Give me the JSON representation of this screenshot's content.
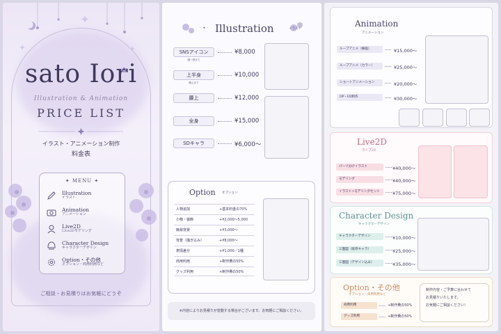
{
  "cover": {
    "name": "sato Iori",
    "subtitle": "Illustration & Animation",
    "price_list": "PRICE LIST",
    "tagline": "イラスト・アニメーション制作",
    "tagline2": "料金表",
    "menu_title": "MENU",
    "menu": [
      {
        "en": "Illustration",
        "jp": "イラスト",
        "icon": "pen-icon"
      },
      {
        "en": "Animation",
        "jp": "アニメーション",
        "icon": "camera-icon"
      },
      {
        "en": "Live2D",
        "jp": "Live2Dモデリング",
        "icon": "character-icon"
      },
      {
        "en": "Character Design",
        "jp": "キャラクターデザイン",
        "icon": "character-head-icon"
      },
      {
        "en": "Option・その他",
        "jp": "オプション・商用利用など",
        "icon": "gear-icon"
      }
    ],
    "footer": "ご相談・お見積りはお気軽にどうぞ"
  },
  "illustration": {
    "title": "Illustration",
    "sub": "イラスト",
    "items": [
      {
        "label": "SNSアイコン",
        "note": "顔〜首まで",
        "price": "¥8,000"
      },
      {
        "label": "上半身",
        "note": "胸上まで",
        "price": "¥10,000"
      },
      {
        "label": "腰上",
        "note": "",
        "price": "¥12,000"
      },
      {
        "label": "全身",
        "note": "",
        "price": "¥15,000"
      },
      {
        "label": "SDキャラ",
        "note": "",
        "price": "¥6,000〜"
      }
    ]
  },
  "option": {
    "title": "Option",
    "sub": "オプション",
    "rows": [
      {
        "k": "人物追加",
        "v": "+基本料金の70%"
      },
      {
        "k": "小物・装飾",
        "v": "+¥2,000〜5,000"
      },
      {
        "k": "簡易背景",
        "v": "+¥3,000〜"
      },
      {
        "k": "背景（描き込み）",
        "v": "+¥8,000〜"
      },
      {
        "k": "表情差分",
        "v": "+¥1,000／1種"
      },
      {
        "k": "商用利用",
        "v": "+制作費の50%"
      },
      {
        "k": "グッズ利用",
        "v": "+制作費の50%"
      }
    ],
    "notice": "※内容によりお見積りが変動する場合がございます。お気軽にご相談ください。"
  },
  "animation": {
    "title": "Animation",
    "sub": "アニメーション",
    "items": [
      {
        "label": "ループアニメ（線画）",
        "price": "¥15,000〜"
      },
      {
        "label": "ループアニメ（カラー）",
        "price": "¥25,000〜"
      },
      {
        "label": "ショートアニメーション",
        "price": "¥20,000〜"
      },
      {
        "label": "OP・ED制作",
        "price": "¥30,000〜"
      }
    ]
  },
  "live2d": {
    "title": "Live2D",
    "sub": "ライブ2D",
    "items": [
      {
        "label": "パーツ分けイラスト",
        "price": "¥40,000〜"
      },
      {
        "label": "モデリング",
        "price": "¥40,000〜"
      },
      {
        "label": "イラスト+モデリングセット",
        "price": "¥75,000〜"
      }
    ]
  },
  "chardesign": {
    "title": "Character Design",
    "sub": "キャラクターデザイン",
    "items": [
      {
        "label": "キャラクターデザイン",
        "price": "¥10,000〜"
      },
      {
        "label": "三面図（既存キャラ）",
        "price": "¥25,000〜"
      },
      {
        "label": "三面図（デザイン込み）",
        "price": "¥35,000〜"
      }
    ]
  },
  "option2": {
    "title": "Option・その他",
    "sub": "オプション・商用利用など",
    "items": [
      {
        "label": "商用利用",
        "price": "+制作費の50%"
      },
      {
        "label": "グッズ利用",
        "price": "+制作費の50%"
      }
    ],
    "note": [
      "制作内容・ご予算に合わせて",
      "お見積りいたします。",
      "お気軽にご相談ください！"
    ]
  },
  "colors": {
    "lavender": "#b9aedb",
    "pink": "#f6d4dc",
    "teal": "#d8ede9",
    "peach": "#f7e2cf",
    "ink": "#3f3a5c"
  }
}
